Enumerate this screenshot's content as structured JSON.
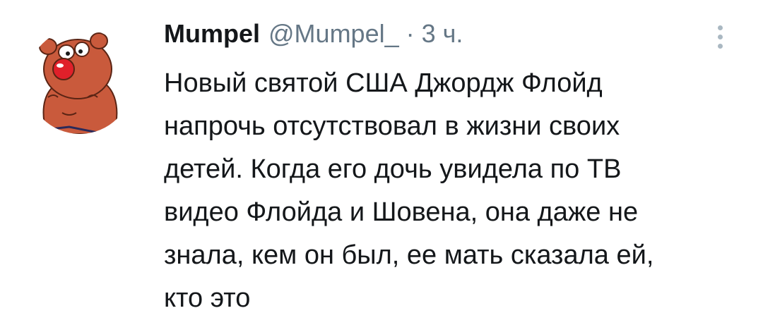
{
  "tweet": {
    "display_name": "Mumpel",
    "handle": "@Mumpel_",
    "separator": "·",
    "time": "3 ч.",
    "text_lines": [
      "Новый святой США Джордж Флойд",
      "напрочь отсутствовал в жизни своих",
      "детей. Когда его дочь увидела по ТВ",
      "видео Флойда и Шовена, она даже не",
      "знала, кем он был, ее мать сказала ей,",
      "кто это"
    ]
  },
  "icons": {
    "avatar": "cartoon-bear-avatar",
    "more": "vertical-ellipsis-icon"
  },
  "colors": {
    "text": "#14171a",
    "secondary": "#657786",
    "icon": "#aab8c2",
    "avatar_bear": "#c95a3c",
    "avatar_nose": "#e0202a"
  }
}
